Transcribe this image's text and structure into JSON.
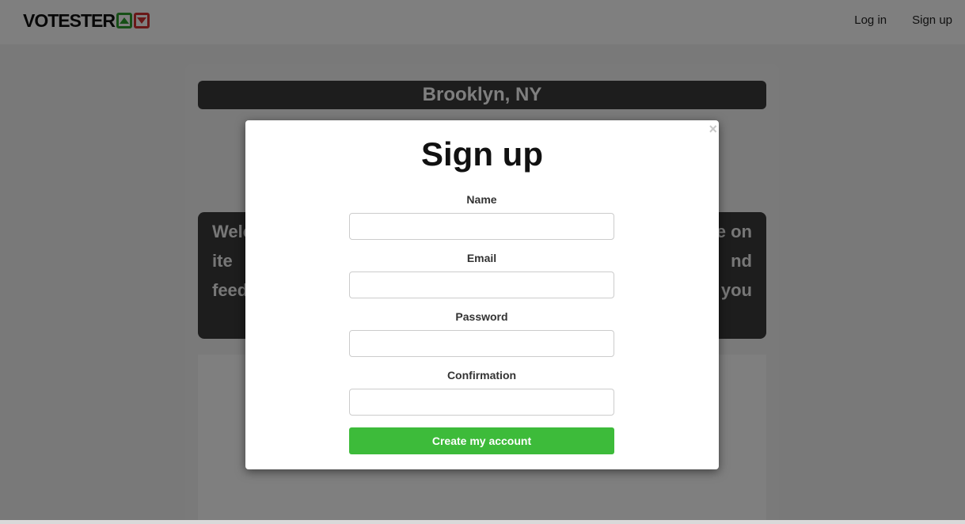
{
  "brand": {
    "name": "VOTESTER",
    "up_icon": "vote-up-icon",
    "down_icon": "vote-down-icon",
    "up_color": "#2e9e2e",
    "down_color": "#d33030"
  },
  "nav": {
    "login": "Log in",
    "signup": "Sign up"
  },
  "page": {
    "location": "Brooklyn, NY",
    "welcome_lines": [
      "Welc",
      "e on",
      "ite",
      "nd",
      "feed",
      "you"
    ]
  },
  "modal": {
    "close": "×",
    "title": "Sign up",
    "fields": {
      "name": {
        "label": "Name",
        "value": ""
      },
      "email": {
        "label": "Email",
        "value": ""
      },
      "password": {
        "label": "Password",
        "value": ""
      },
      "confirmation": {
        "label": "Confirmation",
        "value": ""
      }
    },
    "submit": "Create my account",
    "submit_color": "#3dbb3a"
  }
}
